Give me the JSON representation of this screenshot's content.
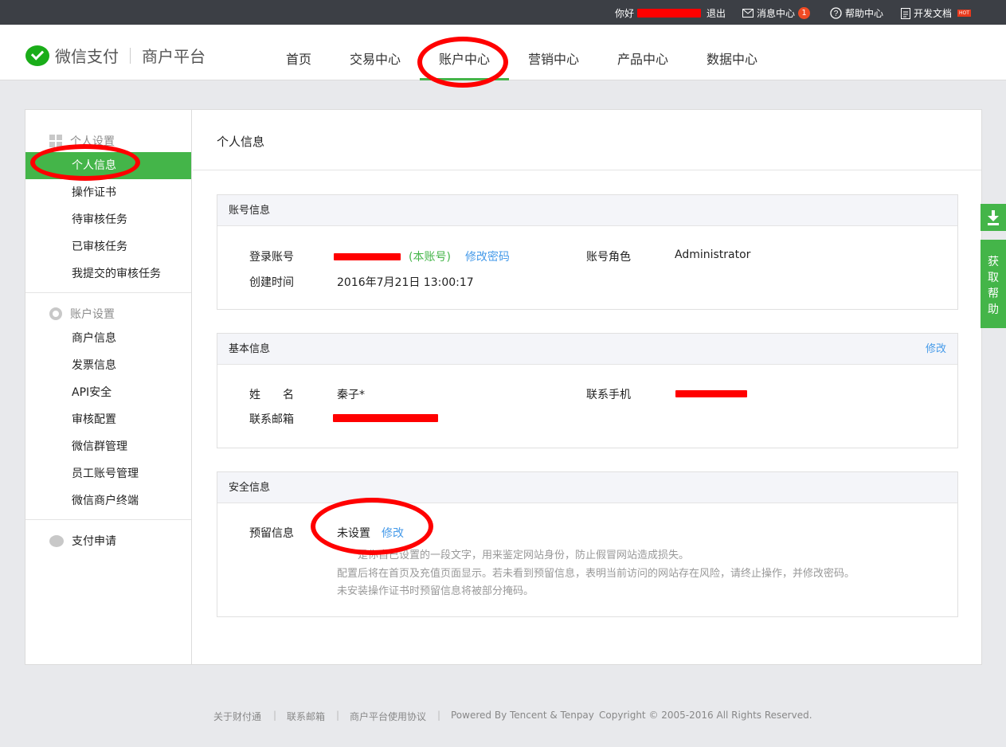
{
  "topbar": {
    "greeting": "你好",
    "logout": "退出",
    "messages": "消息中心",
    "message_count": "1",
    "help": "帮助中心",
    "docs": "开发文档",
    "hot": "HOT"
  },
  "header": {
    "brand": "微信支付",
    "platform": "商户平台",
    "nav": [
      "首页",
      "交易中心",
      "账户中心",
      "营销中心",
      "产品中心",
      "数据中心"
    ],
    "active_nav": "账户中心"
  },
  "sidebar": {
    "group1_title": "个人设置",
    "group1_items": [
      "个人信息",
      "操作证书",
      "待审核任务",
      "已审核任务",
      "我提交的审核任务"
    ],
    "group2_title": "账户设置",
    "group2_items": [
      "商户信息",
      "发票信息",
      "API安全",
      "审核配置",
      "微信群管理",
      "员工账号管理",
      "微信商户终端"
    ],
    "group3_title": "支付申请",
    "active_item": "个人信息"
  },
  "content": {
    "title": "个人信息",
    "account": {
      "heading": "账号信息",
      "login_label": "登录账号",
      "self_tag": "(本账号)",
      "change_password": "修改密码",
      "role_label": "账号角色",
      "role_value": "Administrator",
      "created_label": "创建时间",
      "created_value": "2016年7月21日 13:00:17"
    },
    "basic": {
      "heading": "基本信息",
      "edit": "修改",
      "name_label": "姓　　名",
      "name_value": "秦子*",
      "phone_label": "联系手机",
      "email_label": "联系邮箱"
    },
    "security": {
      "heading": "安全信息",
      "reserve_label": "预留信息",
      "reserve_value": "未设置",
      "edit": "修改",
      "note1": "是你自己设置的一段文字，用来鉴定网站身份，防止假冒网站造成损失。",
      "note2": "配置后将在首页及充值页面显示。若未看到预留信息，表明当前访问的网站存在风险，请终止操作，并修改密码。",
      "note3": "未安装操作证书时预留信息将被部分掩码。"
    }
  },
  "side_tools": {
    "help_chars": [
      "获",
      "取",
      "帮",
      "助"
    ]
  },
  "footer": {
    "about": "关于财付通",
    "contact": "联系邮箱",
    "terms": "商户平台使用协议",
    "powered": "Powered By Tencent & Tenpay",
    "copyright": "Copyright © 2005-2016 All Rights Reserved."
  },
  "colors": {
    "accent": "#44b549",
    "link": "#459ae9",
    "topbar": "#3c3f45",
    "annotation": "#ff0000"
  }
}
